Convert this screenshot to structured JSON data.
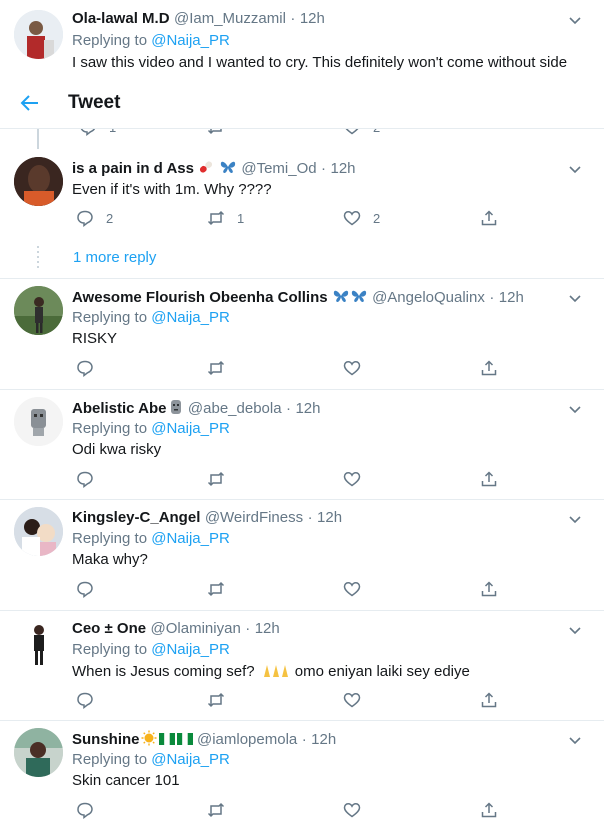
{
  "header": {
    "title": "Tweet"
  },
  "top_tweet": {
    "name": "Ola-lawal M.D",
    "handle": "@Iam_Muzzamil",
    "time": "12h",
    "replying_prefix": "Replying to",
    "replying_to": "@Naija_PR",
    "text": "I saw this video and I wanted to cry. This definitely won't come without side"
  },
  "partial_actions": {
    "reply_count": "1",
    "like_count": "2"
  },
  "temi": {
    "name": "is a pain in d Ass",
    "handle": "@Temi_Od",
    "time": "12h",
    "text": "Even if it's with 1m. Why ????",
    "reply_count": "2",
    "retweet_count": "1",
    "like_count": "2"
  },
  "more_replies": "1 more reply",
  "tweets": [
    {
      "name": "Awesome Flourish Obeenha Collins",
      "handle": "@AngeloQualinx",
      "time": "12h",
      "replying_prefix": "Replying to",
      "replying_to": "@Naija_PR",
      "text": "RISKY"
    },
    {
      "name": "Abelistic Abe",
      "handle": "@abe_debola",
      "time": "12h",
      "replying_prefix": "Replying to",
      "replying_to": "@Naija_PR",
      "text": "Odi kwa risky"
    },
    {
      "name": "Kingsley-C_Angel",
      "handle": "@WeirdFiness",
      "time": "12h",
      "replying_prefix": "Replying to",
      "replying_to": "@Naija_PR",
      "text": "Maka why?"
    },
    {
      "name": "Ceo ± One",
      "handle": "@Olaminiyan",
      "time": "12h",
      "replying_prefix": "Replying to",
      "replying_to": "@Naija_PR",
      "text_a": "When is Jesus coming sef?",
      "text_b": "omo eniyan laiki sey ediye"
    },
    {
      "name": "Sunshine",
      "handle": "@iamlopemola",
      "time": "12h",
      "replying_prefix": "Replying to",
      "replying_to": "@Naija_PR",
      "text": "Skin cancer 101"
    }
  ],
  "colors": {
    "accent": "#1da1f2",
    "muted": "#657786",
    "divider": "#e6ecf0"
  },
  "icons": [
    "back-arrow-icon",
    "chevron-down-icon",
    "reply-icon",
    "retweet-icon",
    "like-icon",
    "share-icon",
    "butterfly-icon",
    "pill-icon",
    "moai-icon",
    "praying-hands-icon",
    "sun-icon",
    "nigeria-flag-icon"
  ]
}
